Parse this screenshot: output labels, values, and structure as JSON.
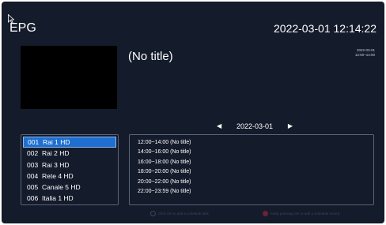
{
  "header": {
    "app_title": "EPG",
    "datetime": "2022-03-01 12:14:22"
  },
  "program_info": {
    "title": "(No title)",
    "date": "2022-03-01",
    "time": "12:00~14:00"
  },
  "date_nav": {
    "prev_icon": "triangle-left-icon",
    "date": "2022-03-01",
    "next_icon": "triangle-right-icon"
  },
  "channels": [
    {
      "num": "001",
      "name": "Rai 1 HD",
      "selected": true
    },
    {
      "num": "002",
      "name": "Rai 2 HD",
      "selected": false
    },
    {
      "num": "003",
      "name": "Rai 3 HD",
      "selected": false
    },
    {
      "num": "004",
      "name": "Rete 4 HD",
      "selected": false
    },
    {
      "num": "005",
      "name": "Canale 5 HD",
      "selected": false
    },
    {
      "num": "006",
      "name": "Italia 1 HD",
      "selected": false
    }
  ],
  "programs": [
    {
      "label": "12:00~14:00 (No title)"
    },
    {
      "label": "14:00~16:00 (No title)"
    },
    {
      "label": "16:00~18:00 (No title)"
    },
    {
      "label": "18:00~20:00 (No title)"
    },
    {
      "label": "20:00~22:00 (No title)"
    },
    {
      "label": "22:00~23:59 (No title)"
    }
  ],
  "hints": {
    "ok_hint": "Click OK to add a schedule task",
    "red_hint": "Keep pressing OK to add a schedule record"
  },
  "colors": {
    "background": "#141b2b",
    "selected": "#1e6fd0",
    "border": "#5a6479"
  }
}
